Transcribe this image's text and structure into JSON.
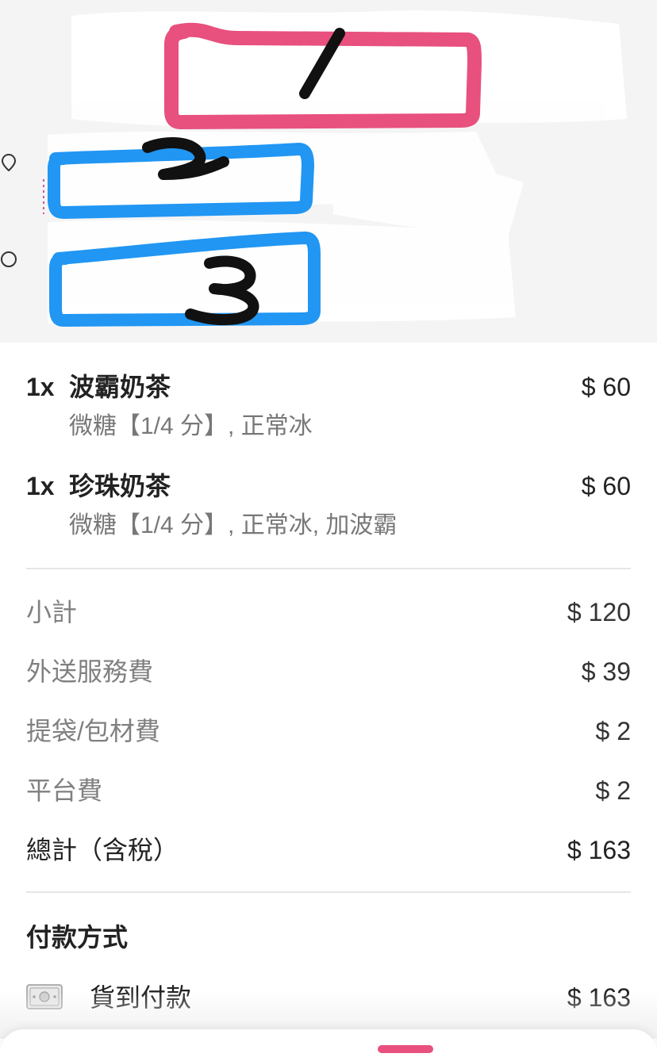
{
  "redacted_header": {
    "box_labels": [
      "1",
      "2",
      "3"
    ]
  },
  "items": [
    {
      "qty": "1x",
      "name": "波霸奶茶",
      "price": "$ 60",
      "options": "微糖【1/4 分】, 正常冰"
    },
    {
      "qty": "1x",
      "name": "珍珠奶茶",
      "price": "$ 60",
      "options": "微糖【1/4 分】, 正常冰, 加波霸"
    }
  ],
  "summary": {
    "subtotal_label": "小計",
    "subtotal_value": "$ 120",
    "delivery_label": "外送服務費",
    "delivery_value": "$ 39",
    "bag_label": "提袋/包材費",
    "bag_value": "$ 2",
    "platform_label": "平台費",
    "platform_value": "$ 2",
    "total_label": "總計（含稅）",
    "total_value": "$ 163"
  },
  "payment": {
    "title": "付款方式",
    "method_icon": "cash-icon",
    "method_label": "貨到付款",
    "amount": "$ 163"
  },
  "colors": {
    "highlight_pink": "#e8507e",
    "highlight_blue": "#2196f3",
    "marker_black": "#111111",
    "text_primary": "#222222",
    "text_secondary": "#808080"
  }
}
